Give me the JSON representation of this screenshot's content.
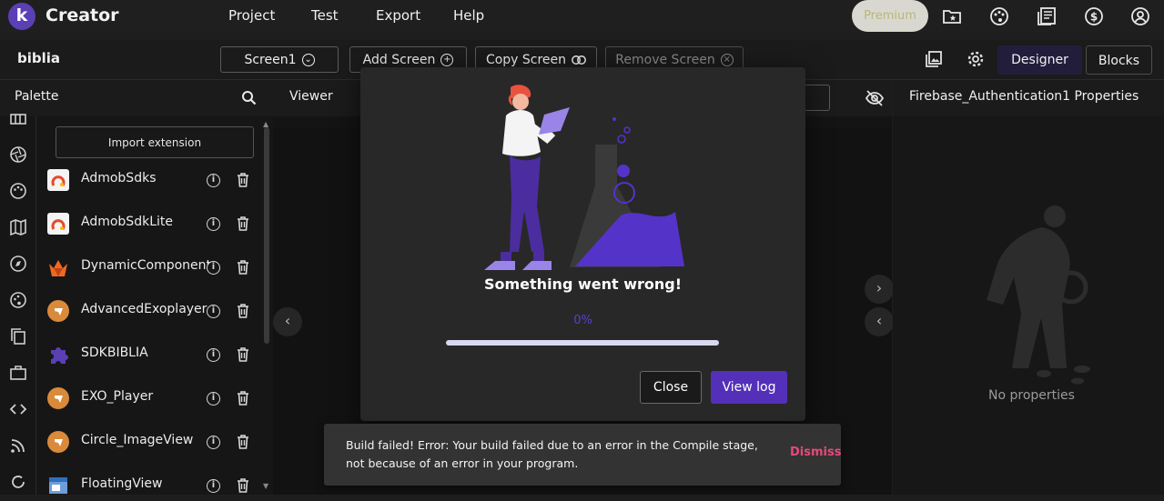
{
  "app": {
    "logo_letter": "k",
    "title": "Creator"
  },
  "menu": [
    "Project",
    "Test",
    "Export",
    "Help"
  ],
  "premium_label": "Premium",
  "top_icons": [
    "folder-star-icon",
    "palette-icon",
    "news-icon",
    "dollar-icon",
    "account-icon"
  ],
  "project": {
    "name": "biblia"
  },
  "screens": {
    "current": "Screen1",
    "add_label": "Add Screen",
    "copy_label": "Copy Screen",
    "remove_label": "Remove Screen"
  },
  "modes": {
    "designer": "Designer",
    "blocks": "Blocks"
  },
  "palette": {
    "title": "Palette",
    "import_label": "Import extension",
    "extensions": [
      {
        "name": "AdmobSdks",
        "logo": "admob-icon"
      },
      {
        "name": "AdmobSdkLite",
        "logo": "admob-icon"
      },
      {
        "name": "DynamicComponents",
        "logo": "dynamic-icon"
      },
      {
        "name": "AdvancedExoplayer",
        "logo": "exo-icon"
      },
      {
        "name": "SDKBIBLIA",
        "logo": "puzzle-icon"
      },
      {
        "name": "EXO_Player",
        "logo": "exo-icon"
      },
      {
        "name": "Circle_ImageView",
        "logo": "exo-icon"
      },
      {
        "name": "FloatingView",
        "logo": "window-icon"
      }
    ],
    "info_glyph": "i"
  },
  "viewer": {
    "title": "Viewer"
  },
  "properties": {
    "title": "Firebase_Authentication1 Properties",
    "empty_text": "No properties"
  },
  "modal": {
    "message": "Something went wrong!",
    "progress_text": "0%",
    "progress": 0,
    "close_label": "Close",
    "view_log_label": "View log"
  },
  "toast": {
    "message": "Build failed! Error: Your build failed due to an error in the Compile stage, not because of an error in your program.",
    "dismiss_label": "Dismiss"
  },
  "colors": {
    "accent": "#5430b8",
    "dismiss": "#e64a7a",
    "background": "#1e1e1e"
  }
}
